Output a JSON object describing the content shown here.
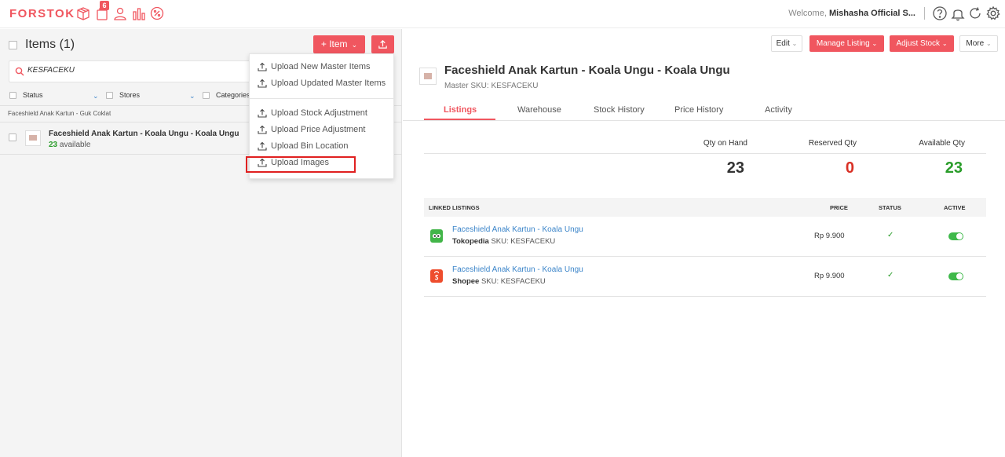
{
  "topbar": {
    "logo": "FORSTOK",
    "notification_count": "6",
    "welcome_prefix": "Welcome, ",
    "user_name": "Mishasha Official S...",
    "icons": [
      "box-icon",
      "bag-icon",
      "user-icon",
      "analytics-icon",
      "promo-icon",
      "help-icon",
      "bell-icon",
      "refresh-icon",
      "gear-icon"
    ]
  },
  "left": {
    "title": "Items (1)",
    "add_item_label": "+ Item",
    "search": {
      "value": "KESFACEKU",
      "placeholder": ""
    },
    "filters": [
      "Status",
      "Stores",
      "Categories"
    ],
    "group_label": "Faceshield Anak Kartun - Guk Coklat",
    "rows": [
      {
        "title": "Faceshield Anak Kartun - Koala Ungu - Koala Ungu",
        "qty": "23",
        "qty_suffix": " available"
      }
    ]
  },
  "upload_menu": {
    "items": [
      "Upload New Master Items",
      "Upload Updated Master Items",
      "Upload Stock Adjustment",
      "Upload Price Adjustment",
      "Upload Bin Location",
      "Upload Images"
    ],
    "highlighted": "Upload Images"
  },
  "right": {
    "buttons": {
      "edit": "Edit",
      "manage_listing": "Manage Listing",
      "adjust_stock": "Adjust Stock",
      "more": "More"
    },
    "product": {
      "title": "Faceshield Anak Kartun - Koala Ungu - Koala Ungu",
      "sku": "Master SKU: KESFACEKU"
    },
    "tabs": [
      "Listings",
      "Warehouse",
      "Stock History",
      "Price History",
      "Activity"
    ],
    "active_tab": "Listings",
    "qty": {
      "on_hand_label": "Qty on Hand",
      "on_hand": "23",
      "reserved_label": "Reserved Qty",
      "reserved": "0",
      "available_label": "Available Qty",
      "available": "23"
    },
    "linked": {
      "header": {
        "title": "LINKED LISTINGS",
        "price": "PRICE",
        "status": "STATUS",
        "active": "ACTIVE"
      },
      "rows": [
        {
          "name": "Faceshield Anak Kartun - Koala Ungu",
          "marketplace": "Tokopedia",
          "sku": " SKU: KESFACEKU",
          "price": "Rp  9.900",
          "status": "✓",
          "active": true,
          "icon_color": "#42b549"
        },
        {
          "name": "Faceshield Anak Kartun - Koala Ungu",
          "marketplace": "Shopee",
          "sku": " SKU: KESFACEKU",
          "price": "Rp  9.900",
          "status": "✓",
          "active": true,
          "icon_color": "#ee4d2d"
        }
      ]
    }
  },
  "colors": {
    "brand": "#f0565f",
    "success": "#2a9d2a",
    "danger": "#d93025",
    "link": "#3a84c9",
    "toggle_on": "#3fb94a"
  }
}
